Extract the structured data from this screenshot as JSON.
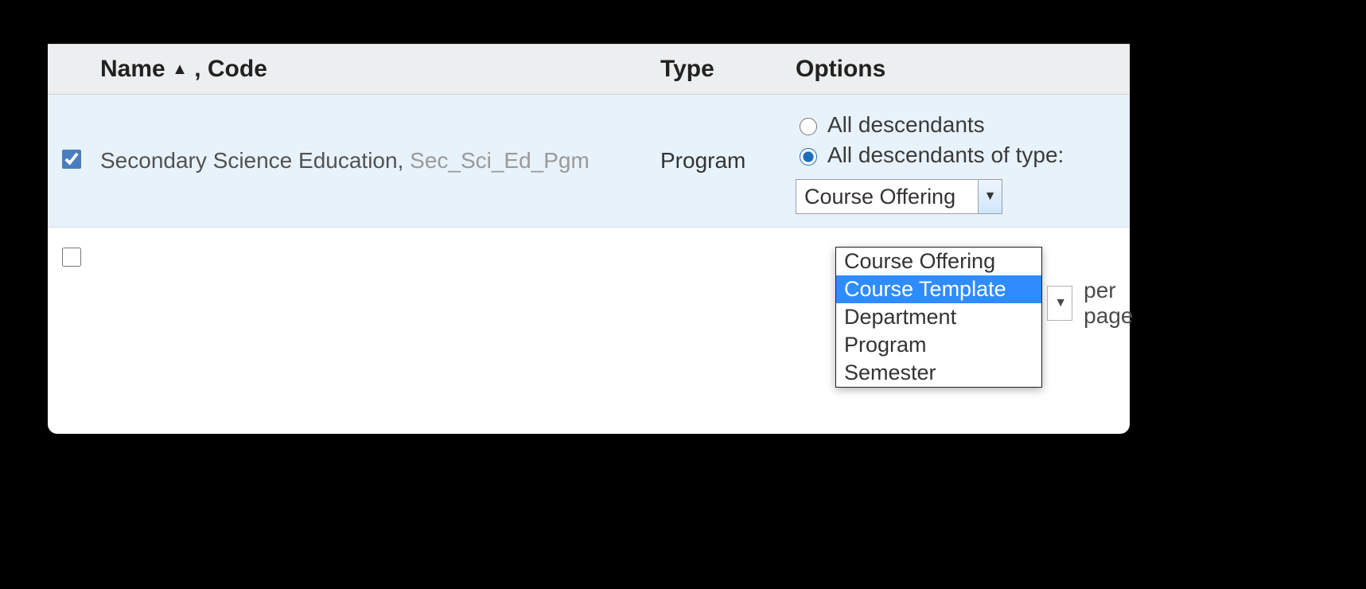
{
  "header": {
    "name_label": "Name",
    "sort_indicator": "▲",
    "code_label": ", Code",
    "type_label": "Type",
    "options_label": "Options"
  },
  "row": {
    "checked": true,
    "name": "Secondary Science Education",
    "code": "Sec_Sci_Ed_Pgm",
    "type": "Program",
    "option_all_descendants": "All descendants",
    "option_all_descendants_of_type": "All descendants of type:",
    "selected_option": "type",
    "type_select_value": "Course Offering"
  },
  "dropdown_options": [
    "Course Offering",
    "Course Template",
    "Department",
    "Program",
    "Semester"
  ],
  "dropdown_highlight_index": 1,
  "footer": {
    "per_page_label": "per page"
  }
}
